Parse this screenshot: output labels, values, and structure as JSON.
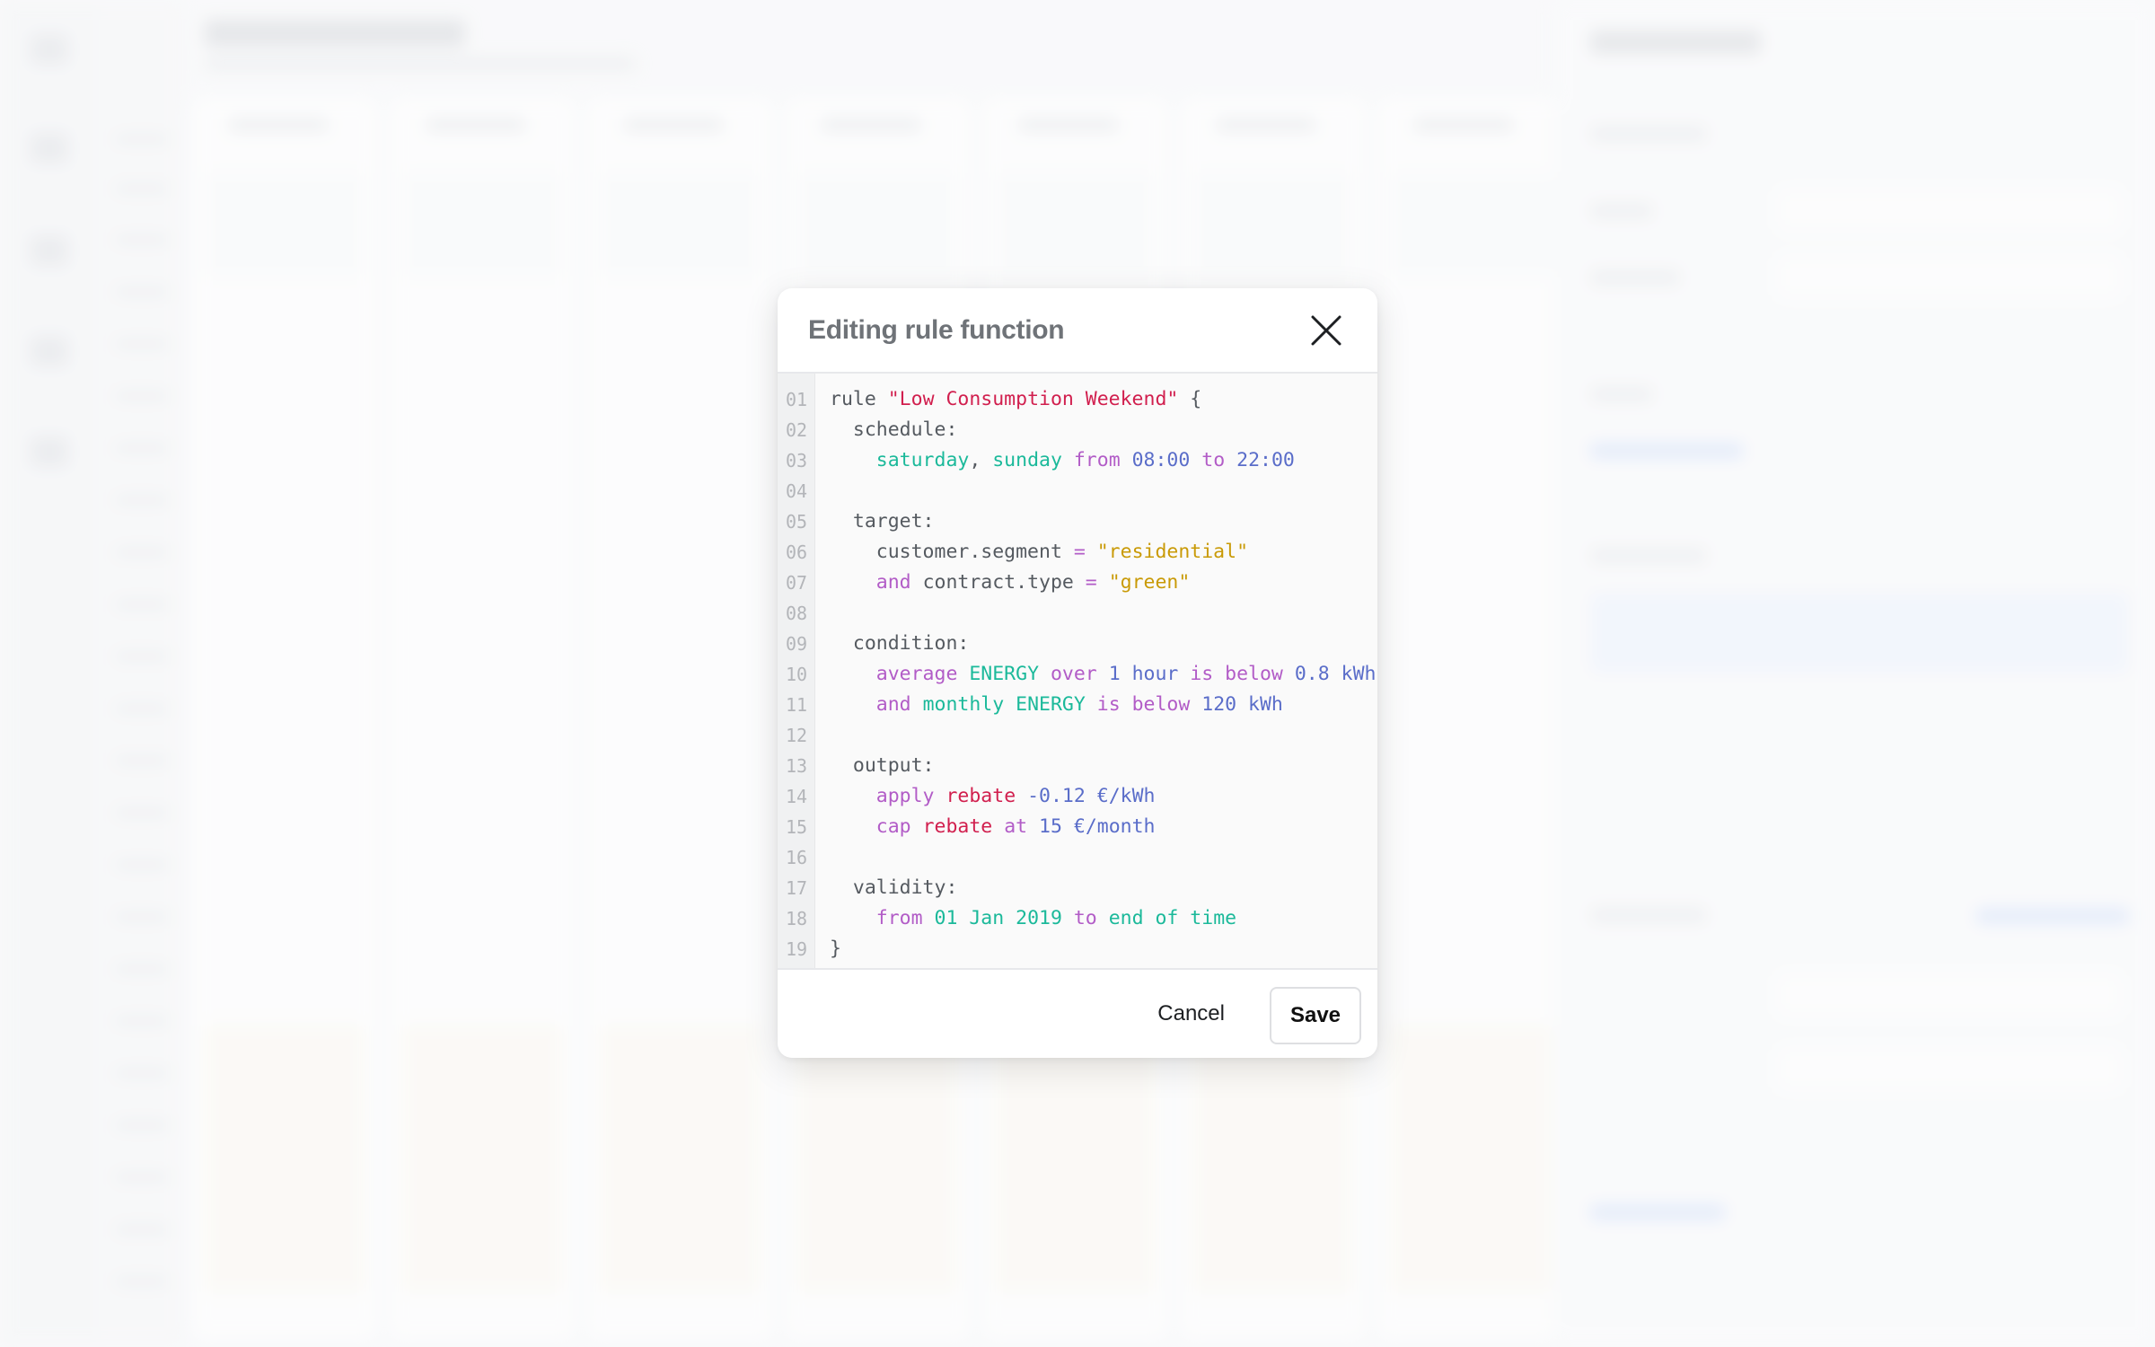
{
  "modal": {
    "title": "Editing rule function",
    "cancel_label": "Cancel",
    "save_label": "Save"
  },
  "code_lines": [
    {
      "n": "01",
      "tokens": [
        [
          "plain",
          "rule "
        ],
        [
          "str",
          "\"Low Consumption Weekend\""
        ],
        [
          "plain",
          " {"
        ]
      ]
    },
    {
      "n": "02",
      "tokens": [
        [
          "plain",
          "  schedule:"
        ]
      ]
    },
    {
      "n": "03",
      "tokens": [
        [
          "plain",
          "    "
        ],
        [
          "teal",
          "saturday"
        ],
        [
          "plain",
          ", "
        ],
        [
          "teal",
          "sunday"
        ],
        [
          "plain",
          " "
        ],
        [
          "op",
          "from"
        ],
        [
          "plain",
          " "
        ],
        [
          "num",
          "08:00"
        ],
        [
          "plain",
          " "
        ],
        [
          "op",
          "to"
        ],
        [
          "plain",
          " "
        ],
        [
          "num",
          "22:00"
        ]
      ]
    },
    {
      "n": "04",
      "tokens": []
    },
    {
      "n": "05",
      "tokens": [
        [
          "plain",
          "  target:"
        ]
      ]
    },
    {
      "n": "06",
      "tokens": [
        [
          "plain",
          "    customer.segment "
        ],
        [
          "op",
          "="
        ],
        [
          "plain",
          " "
        ],
        [
          "val",
          "\"residential\""
        ]
      ]
    },
    {
      "n": "07",
      "tokens": [
        [
          "plain",
          "    "
        ],
        [
          "op",
          "and"
        ],
        [
          "plain",
          " contract.type "
        ],
        [
          "op",
          "="
        ],
        [
          "plain",
          " "
        ],
        [
          "val",
          "\"green\""
        ]
      ]
    },
    {
      "n": "08",
      "tokens": []
    },
    {
      "n": "09",
      "tokens": [
        [
          "plain",
          "  condition:"
        ]
      ]
    },
    {
      "n": "10",
      "tokens": [
        [
          "plain",
          "    "
        ],
        [
          "op",
          "average"
        ],
        [
          "plain",
          " "
        ],
        [
          "teal",
          "ENERGY"
        ],
        [
          "plain",
          " "
        ],
        [
          "op",
          "over"
        ],
        [
          "plain",
          " "
        ],
        [
          "num",
          "1 hour"
        ],
        [
          "plain",
          " "
        ],
        [
          "op",
          "is below"
        ],
        [
          "plain",
          " "
        ],
        [
          "num",
          "0.8 kWh"
        ]
      ]
    },
    {
      "n": "11",
      "tokens": [
        [
          "plain",
          "    "
        ],
        [
          "op",
          "and"
        ],
        [
          "plain",
          " "
        ],
        [
          "teal",
          "monthly ENERGY"
        ],
        [
          "plain",
          " "
        ],
        [
          "op",
          "is below"
        ],
        [
          "plain",
          " "
        ],
        [
          "num",
          "120 kWh"
        ]
      ]
    },
    {
      "n": "12",
      "tokens": []
    },
    {
      "n": "13",
      "tokens": [
        [
          "plain",
          "  output:"
        ]
      ]
    },
    {
      "n": "14",
      "tokens": [
        [
          "plain",
          "    "
        ],
        [
          "op",
          "apply"
        ],
        [
          "plain",
          " "
        ],
        [
          "red",
          "rebate"
        ],
        [
          "plain",
          " "
        ],
        [
          "num",
          "-0.12 €/kWh"
        ]
      ]
    },
    {
      "n": "15",
      "tokens": [
        [
          "plain",
          "    "
        ],
        [
          "op",
          "cap"
        ],
        [
          "plain",
          " "
        ],
        [
          "red",
          "rebate"
        ],
        [
          "plain",
          " "
        ],
        [
          "op",
          "at"
        ],
        [
          "plain",
          " "
        ],
        [
          "num",
          "15 €/month"
        ]
      ]
    },
    {
      "n": "16",
      "tokens": []
    },
    {
      "n": "17",
      "tokens": [
        [
          "plain",
          "  validity:"
        ]
      ]
    },
    {
      "n": "18",
      "tokens": [
        [
          "plain",
          "    "
        ],
        [
          "op",
          "from"
        ],
        [
          "plain",
          " "
        ],
        [
          "teal",
          "01 Jan 2019"
        ],
        [
          "plain",
          " "
        ],
        [
          "op",
          "to"
        ],
        [
          "plain",
          " "
        ],
        [
          "teal",
          "end of time"
        ]
      ]
    },
    {
      "n": "19",
      "tokens": [
        [
          "plain",
          "}"
        ]
      ]
    }
  ],
  "colors": {
    "string": "#d11f4e",
    "value": "#c99a06",
    "operator": "#b25cc7",
    "teal": "#1bb99a",
    "number": "#5a6dc9",
    "plain": "#555a60"
  }
}
